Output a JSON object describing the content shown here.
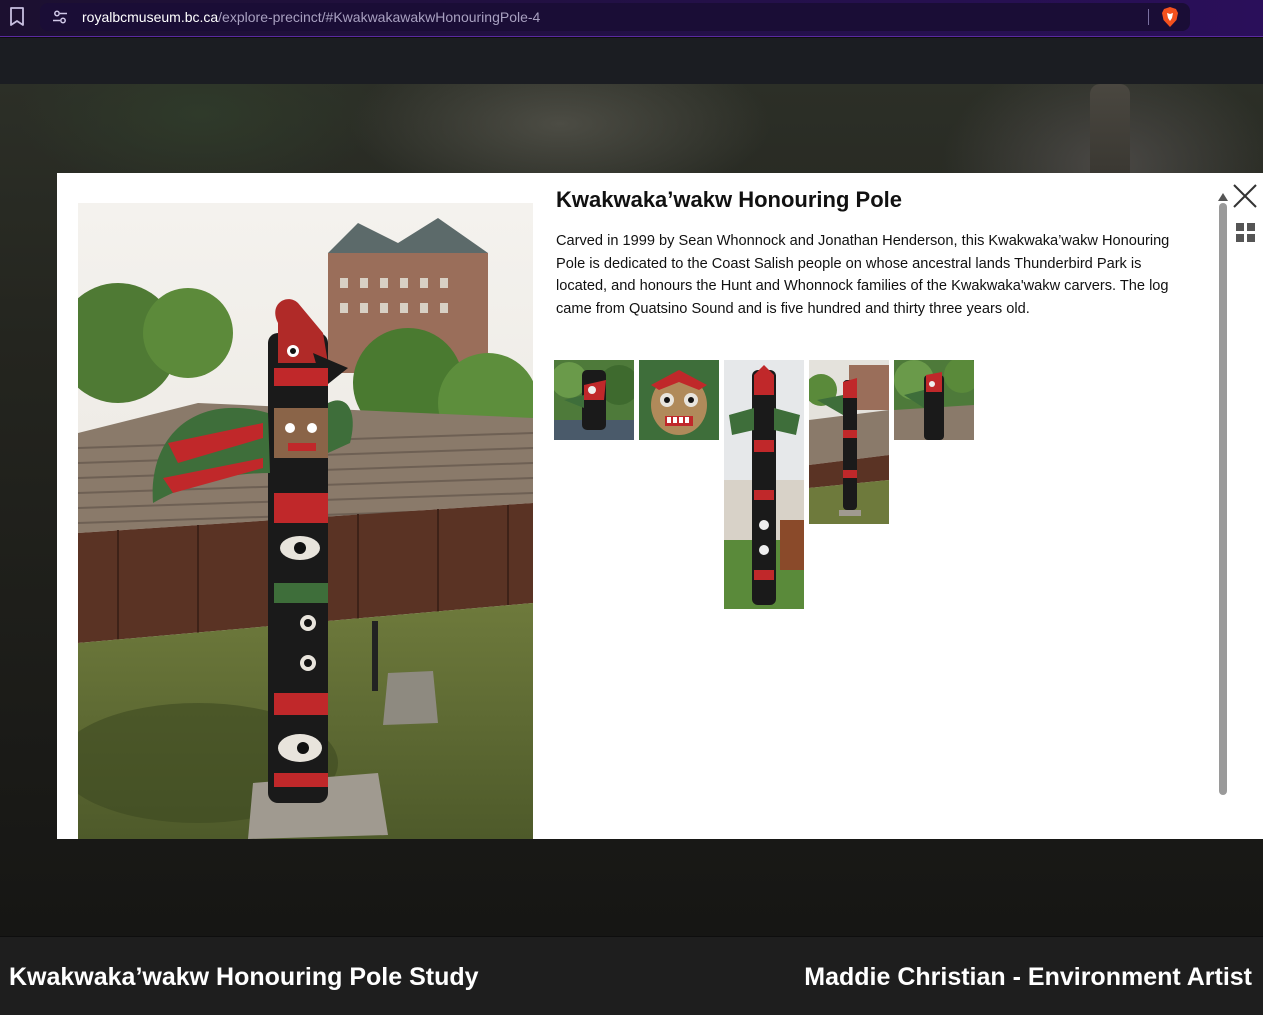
{
  "browser": {
    "url_host": "royalbcmuseum.bc.ca",
    "url_path": "/explore-precinct/#KwakwakawakwHonouringPole-4",
    "icons": [
      "bookmark-icon",
      "site-settings-icon",
      "brave-shield-icon"
    ]
  },
  "modal": {
    "title": "Kwakwaka’wakw Honouring Pole",
    "description": "Carved in 1999 by Sean Whonnock and Jonathan Henderson, this Kwakwaka’wakw Honouring Pole is dedicated to the Coast Salish people on whose ancestral lands Thunderbird Park is located, and honours the Hunt and Whonnock families of the Kwakwaka'wakw carvers. The log came from Quatsino Sound and is five hundred and thirty three years old.",
    "thumbnail_count": 5,
    "icons": [
      "close-icon",
      "grid-view-icon"
    ]
  },
  "caption": {
    "left": "Kwakwaka’wakw Honouring Pole Study",
    "right": "Maddie Christian - Environment Artist"
  },
  "colors": {
    "accent_red": "#c0282a",
    "accent_green": "#3e6e3a",
    "pole_black": "#1a1a1a",
    "caption_bg": "#1e1e1e"
  }
}
